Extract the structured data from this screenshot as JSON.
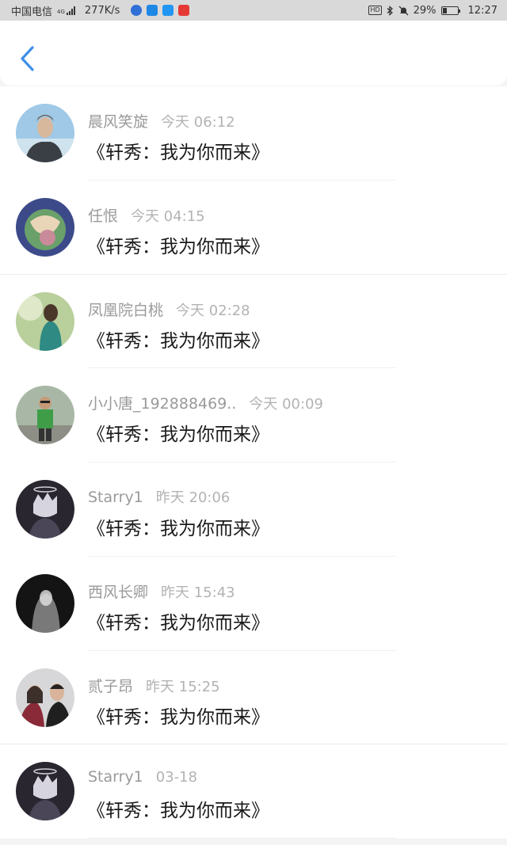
{
  "status_bar": {
    "carrier": "中国电信",
    "network_type": "4G",
    "speed": "277K/s",
    "battery": "29%",
    "battery_level": 0.29,
    "time": "12:27",
    "hd_label": "HD"
  },
  "header": {
    "back_icon": "chevron-left-icon",
    "accent_color": "#3d8fe8"
  },
  "comments": [
    {
      "name": "晨风笑旋",
      "time": "今天 06:12",
      "text": "《轩秀：我为你而来》"
    },
    {
      "name": "任恨",
      "time": "今天 04:15",
      "text": "《轩秀：我为你而来》"
    },
    {
      "name": "凤凰院白桃",
      "time": "今天 02:28",
      "text": "《轩秀：我为你而来》"
    },
    {
      "name": "小小唐_192888469..",
      "time": "今天 00:09",
      "text": "《轩秀：我为你而来》"
    },
    {
      "name": "Starry1",
      "time": "昨天 20:06",
      "text": "《轩秀：我为你而来》"
    },
    {
      "name": "西风长卿",
      "time": "昨天 15:43",
      "text": "《轩秀：我为你而来》"
    },
    {
      "name": "贰子昂",
      "time": "昨天 15:25",
      "text": "《轩秀：我为你而来》"
    },
    {
      "name": "Starry1",
      "time": "03-18",
      "text": "《轩秀：我为你而来》"
    }
  ]
}
